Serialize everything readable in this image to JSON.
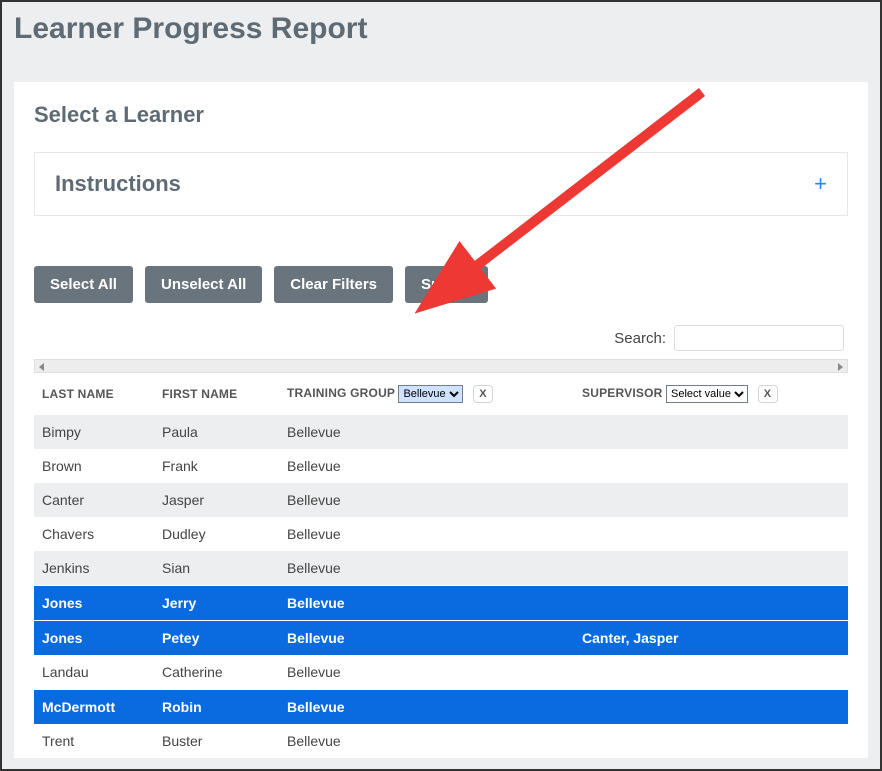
{
  "page": {
    "title": "Learner Progress Report"
  },
  "section": {
    "title": "Select a Learner",
    "instructions_label": "Instructions",
    "expand_symbol": "+"
  },
  "buttons": {
    "select_all": "Select All",
    "unselect_all": "Unselect All",
    "clear_filters": "Clear Filters",
    "submit": "Submit"
  },
  "search": {
    "label": "Search:",
    "value": ""
  },
  "table": {
    "headers": {
      "last_name": "LAST NAME",
      "first_name": "FIRST NAME",
      "training_group": "TRAINING GROUP",
      "supervisor": "SUPERVISOR"
    },
    "filters": {
      "training_group": {
        "selected": "Bellevue",
        "clear": "X"
      },
      "supervisor": {
        "selected": "Select value",
        "clear": "X"
      }
    },
    "rows": [
      {
        "last_name": "Bimpy",
        "first_name": "Paula",
        "training_group": "Bellevue",
        "supervisor": "",
        "selected": false
      },
      {
        "last_name": "Brown",
        "first_name": "Frank",
        "training_group": "Bellevue",
        "supervisor": "",
        "selected": false
      },
      {
        "last_name": "Canter",
        "first_name": "Jasper",
        "training_group": "Bellevue",
        "supervisor": "",
        "selected": false
      },
      {
        "last_name": "Chavers",
        "first_name": "Dudley",
        "training_group": "Bellevue",
        "supervisor": "",
        "selected": false
      },
      {
        "last_name": "Jenkins",
        "first_name": "Sian",
        "training_group": "Bellevue",
        "supervisor": "",
        "selected": false
      },
      {
        "last_name": "Jones",
        "first_name": "Jerry",
        "training_group": "Bellevue",
        "supervisor": "",
        "selected": true
      },
      {
        "last_name": "Jones",
        "first_name": "Petey",
        "training_group": "Bellevue",
        "supervisor": "Canter, Jasper",
        "selected": true
      },
      {
        "last_name": "Landau",
        "first_name": "Catherine",
        "training_group": "Bellevue",
        "supervisor": "",
        "selected": false
      },
      {
        "last_name": "McDermott",
        "first_name": "Robin",
        "training_group": "Bellevue",
        "supervisor": "",
        "selected": true
      },
      {
        "last_name": "Trent",
        "first_name": "Buster",
        "training_group": "Bellevue",
        "supervisor": "",
        "selected": false
      }
    ]
  },
  "annotation": {
    "arrow_color": "#ed3833"
  }
}
